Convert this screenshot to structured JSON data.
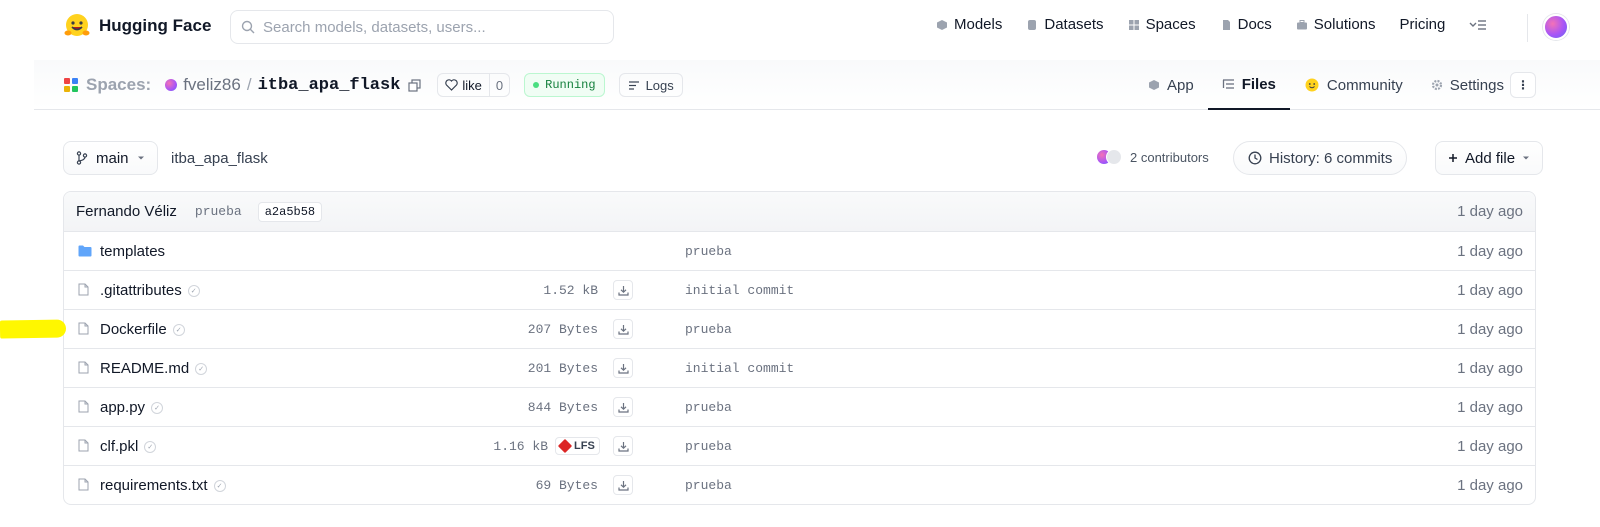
{
  "brand": {
    "name": "Hugging Face"
  },
  "search": {
    "placeholder": "Search models, datasets, users..."
  },
  "nav": [
    {
      "label": "Models",
      "icon": "cube-icon"
    },
    {
      "label": "Datasets",
      "icon": "database-icon"
    },
    {
      "label": "Spaces",
      "icon": "grid-icon"
    },
    {
      "label": "Docs",
      "icon": "doc-icon"
    },
    {
      "label": "Solutions",
      "icon": "briefcase-icon"
    },
    {
      "label": "Pricing",
      "icon": ""
    }
  ],
  "repo": {
    "section": "Spaces:",
    "owner": "fveliz86",
    "separator": "/",
    "name": "itba_apa_flask",
    "like_label": "like",
    "like_count": "0",
    "status": "Running",
    "logs_label": "Logs"
  },
  "tabs": [
    {
      "label": "App",
      "active": false
    },
    {
      "label": "Files",
      "active": true
    },
    {
      "label": "Community",
      "active": false
    },
    {
      "label": "Settings",
      "active": false
    }
  ],
  "toolbar": {
    "branch": "main",
    "breadcrumb": "itba_apa_flask",
    "contributors": "2 contributors",
    "history": "History: 6 commits",
    "add_file": "Add file"
  },
  "last_commit": {
    "author": "Fernando Véliz",
    "message": "prueba",
    "hash": "a2a5b58",
    "time": "1 day ago"
  },
  "files": [
    {
      "name": "templates",
      "type": "folder",
      "size": "",
      "lfs": false,
      "message": "prueba",
      "time": "1 day ago"
    },
    {
      "name": ".gitattributes",
      "type": "file",
      "size": "1.52 kB",
      "lfs": false,
      "message": "initial commit",
      "time": "1 day ago"
    },
    {
      "name": "Dockerfile",
      "type": "file",
      "size": "207 Bytes",
      "lfs": false,
      "message": "prueba",
      "time": "1 day ago"
    },
    {
      "name": "README.md",
      "type": "file",
      "size": "201 Bytes",
      "lfs": false,
      "message": "initial commit",
      "time": "1 day ago"
    },
    {
      "name": "app.py",
      "type": "file",
      "size": "844 Bytes",
      "lfs": false,
      "message": "prueba",
      "time": "1 day ago"
    },
    {
      "name": "clf.pkl",
      "type": "file",
      "size": "1.16 kB",
      "lfs": true,
      "lfs_label": "LFS",
      "message": "prueba",
      "time": "1 day ago"
    },
    {
      "name": "requirements.txt",
      "type": "file",
      "size": "69 Bytes",
      "lfs": false,
      "message": "prueba",
      "time": "1 day ago"
    }
  ],
  "colors": {
    "running_bg": "#f0fdf4",
    "running_text": "#15803d",
    "folder": "#60a5fa",
    "highlight": "#fff700"
  }
}
